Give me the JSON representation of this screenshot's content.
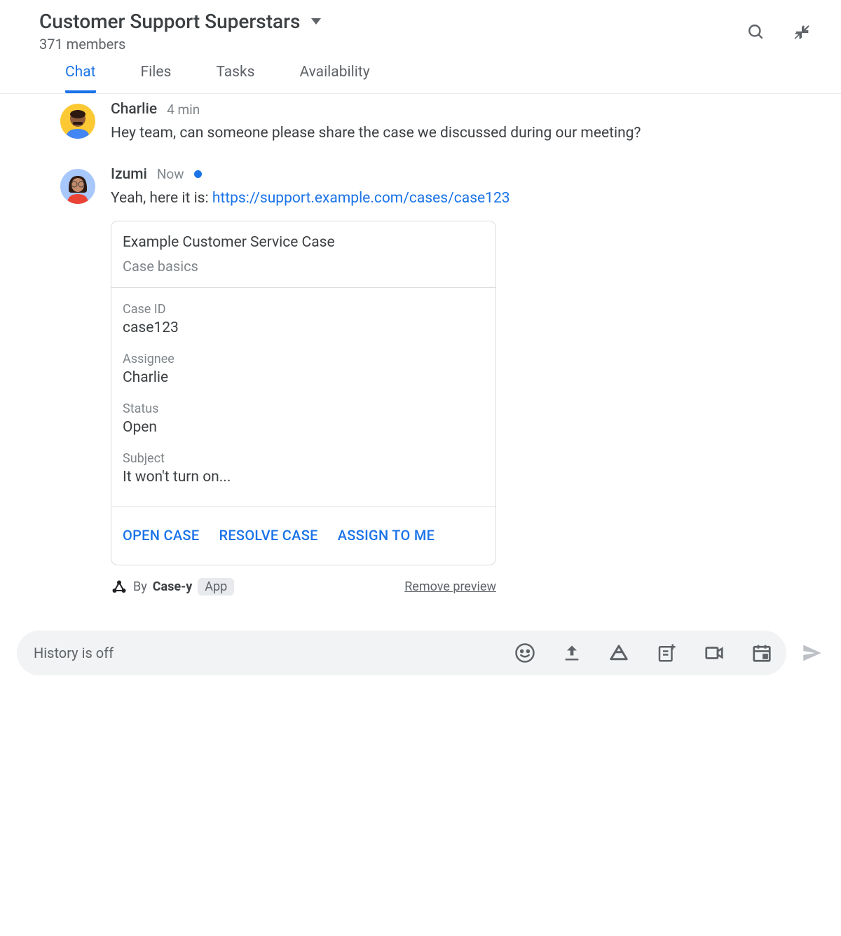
{
  "header": {
    "title": "Customer Support Superstars",
    "members": "371 members"
  },
  "tabs": [
    {
      "label": "Chat",
      "active": true
    },
    {
      "label": "Files",
      "active": false
    },
    {
      "label": "Tasks",
      "active": false
    },
    {
      "label": "Availability",
      "active": false
    }
  ],
  "messages": [
    {
      "author": "Charlie",
      "time": "4 min",
      "text": "Hey team, can someone please share the case we discussed during our meeting?"
    },
    {
      "author": "Izumi",
      "time": "Now",
      "text_prefix": "Yeah, here it is: ",
      "link": "https://support.example.com/cases/case123"
    }
  ],
  "card": {
    "title": "Example Customer Service Case",
    "subtitle": "Case basics",
    "fields": [
      {
        "label": "Case ID",
        "value": "case123"
      },
      {
        "label": "Assignee",
        "value": "Charlie"
      },
      {
        "label": "Status",
        "value": "Open"
      },
      {
        "label": "Subject",
        "value": "It won't turn on..."
      }
    ],
    "actions": [
      "OPEN CASE",
      "RESOLVE CASE",
      "ASSIGN TO ME"
    ]
  },
  "attribution": {
    "by": "By",
    "app_name": "Case-y",
    "badge": "App",
    "remove": "Remove preview"
  },
  "composer": {
    "placeholder": "History is off"
  }
}
